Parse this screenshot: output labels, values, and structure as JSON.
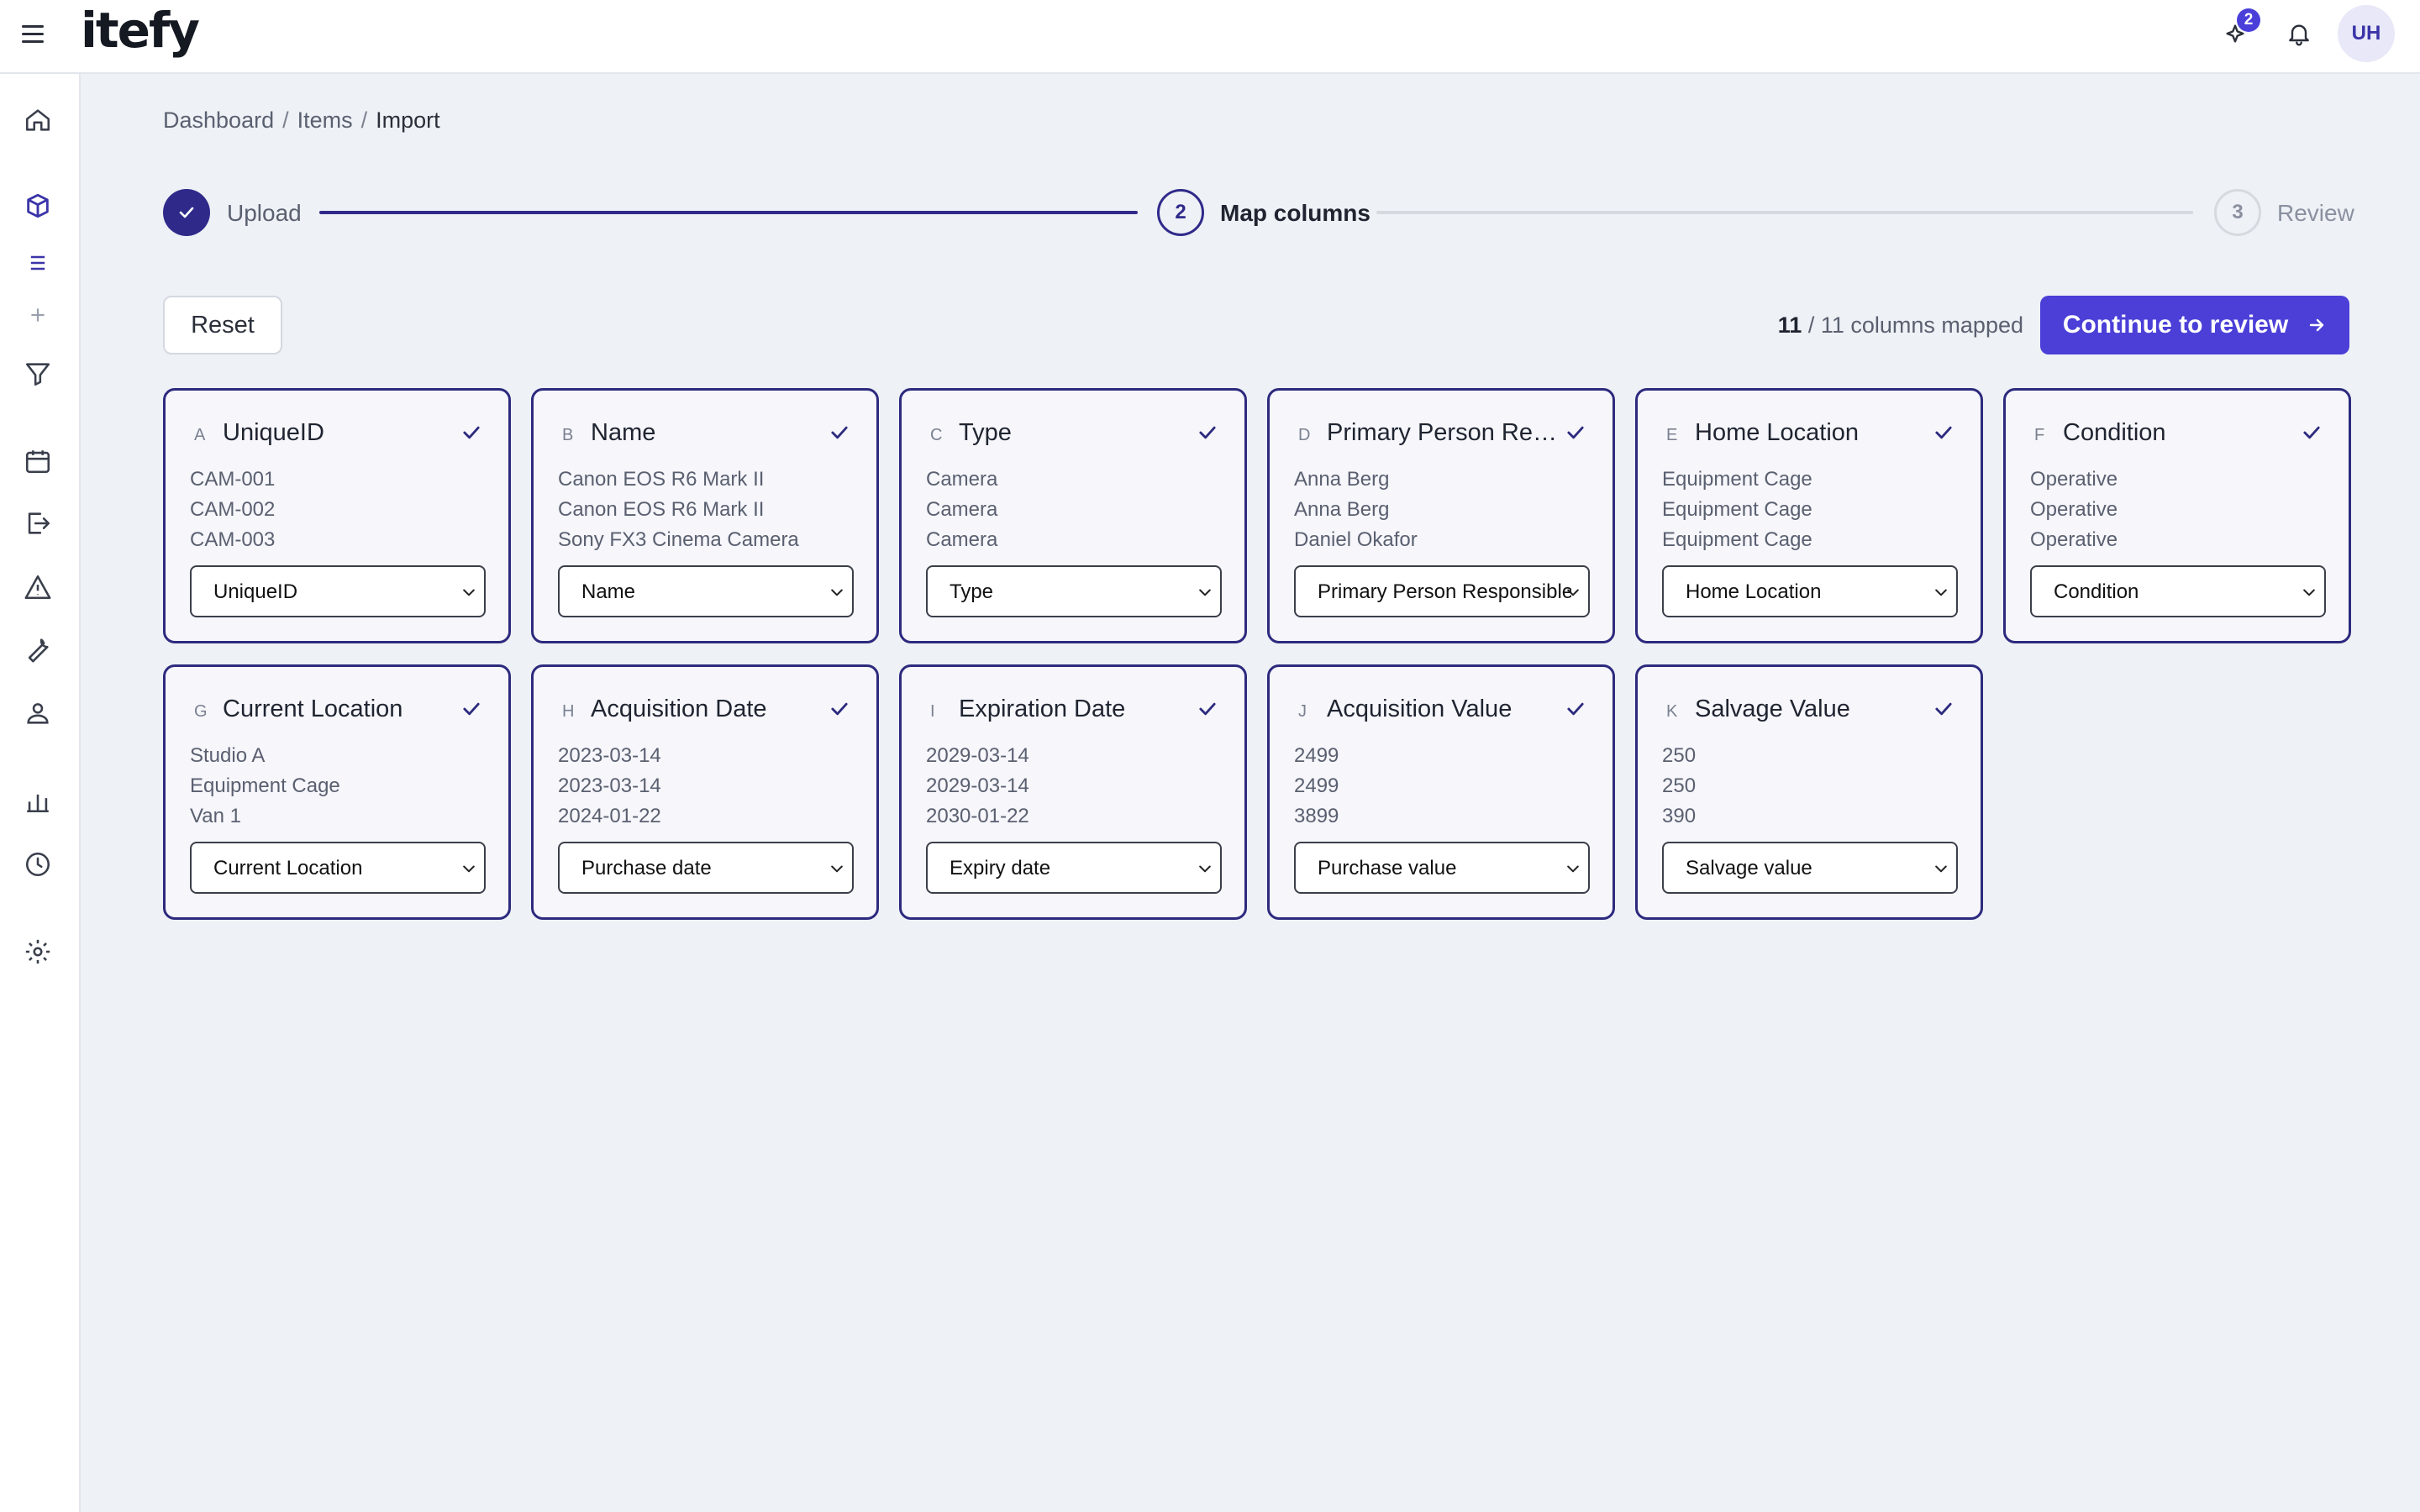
{
  "app": {
    "logo": "itefy"
  },
  "header": {
    "notification_badge": "2",
    "avatar_initials": "UH"
  },
  "sidebar": {
    "icons": [
      "home-icon",
      "box-icon",
      "list-icon",
      "plus-icon",
      "filter-icon",
      "calendar-icon",
      "checkout-icon",
      "alert-icon",
      "wrench-icon",
      "team-icon",
      "chart-icon",
      "history-icon",
      "settings-icon"
    ]
  },
  "breadcrumb": {
    "items": [
      "Dashboard",
      "Items",
      "Import"
    ]
  },
  "stepper": {
    "steps": [
      {
        "number": "1",
        "label": "Upload",
        "state": "done"
      },
      {
        "number": "2",
        "label": "Map columns",
        "state": "active"
      },
      {
        "number": "3",
        "label": "Review",
        "state": "pending"
      }
    ]
  },
  "toolbar": {
    "reset_label": "Reset",
    "mapped_count": "11",
    "mapped_total": "/ 11 columns mapped",
    "continue_label": "Continue to review"
  },
  "colors": {
    "accent": "#4b3fd8",
    "card_border": "#2d2a7e",
    "background": "#eef1f5"
  },
  "columns": [
    {
      "letter": "A",
      "title": "UniqueID",
      "samples": [
        "CAM-001",
        "CAM-002",
        "CAM-003"
      ],
      "mapping": "UniqueID"
    },
    {
      "letter": "B",
      "title": "Name",
      "samples": [
        "Canon EOS R6 Mark II",
        "Canon EOS R6 Mark II",
        "Sony FX3 Cinema Camera"
      ],
      "mapping": "Name"
    },
    {
      "letter": "C",
      "title": "Type",
      "samples": [
        "Camera",
        "Camera",
        "Camera"
      ],
      "mapping": "Type"
    },
    {
      "letter": "D",
      "title": "Primary Person Res...",
      "samples": [
        "Anna Berg",
        "Anna Berg",
        "Daniel Okafor"
      ],
      "mapping": "Primary Person Responsible"
    },
    {
      "letter": "E",
      "title": "Home Location",
      "samples": [
        "Equipment Cage",
        "Equipment Cage",
        "Equipment Cage"
      ],
      "mapping": "Home Location"
    },
    {
      "letter": "F",
      "title": "Condition",
      "samples": [
        "Operative",
        "Operative",
        "Operative"
      ],
      "mapping": "Condition"
    },
    {
      "letter": "G",
      "title": "Current Location",
      "samples": [
        "Studio A",
        "Equipment Cage",
        "Van 1"
      ],
      "mapping": "Current Location"
    },
    {
      "letter": "H",
      "title": "Acquisition Date",
      "samples": [
        "2023-03-14",
        "2023-03-14",
        "2024-01-22"
      ],
      "mapping": "Purchase date"
    },
    {
      "letter": "I",
      "title": "Expiration Date",
      "samples": [
        "2029-03-14",
        "2029-03-14",
        "2030-01-22"
      ],
      "mapping": "Expiry date"
    },
    {
      "letter": "J",
      "title": "Acquisition Value",
      "samples": [
        "2499",
        "2499",
        "3899"
      ],
      "mapping": "Purchase value"
    },
    {
      "letter": "K",
      "title": "Salvage Value",
      "samples": [
        "250",
        "250",
        "390"
      ],
      "mapping": "Salvage value"
    }
  ]
}
